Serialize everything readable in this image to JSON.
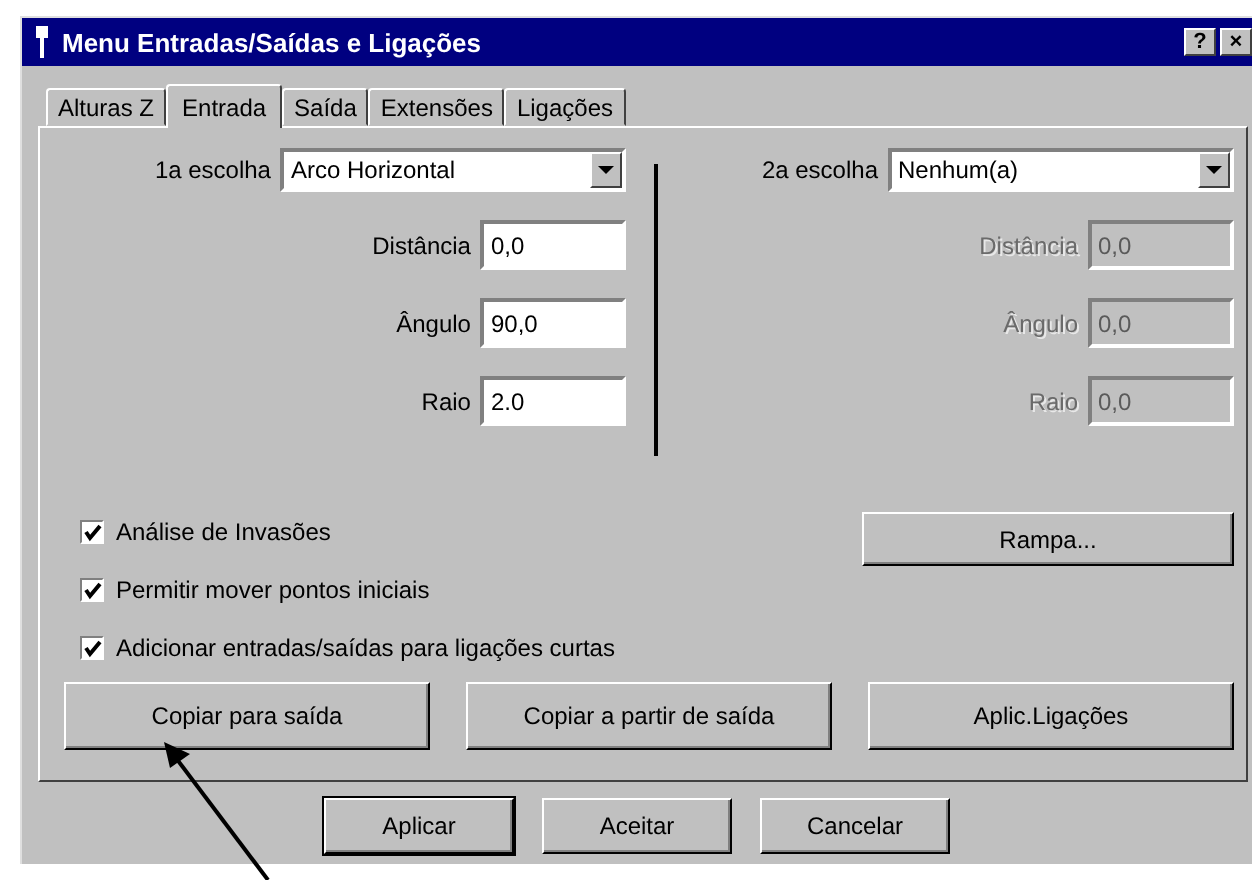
{
  "window": {
    "title": "Menu Entradas/Saídas e Ligações",
    "title_buttons": [
      "?",
      "×"
    ]
  },
  "tabs": [
    {
      "label": "Alturas Z",
      "selected": false
    },
    {
      "label": "Entrada",
      "selected": true
    },
    {
      "label": "Saída",
      "selected": false
    },
    {
      "label": "Extensões",
      "selected": false
    },
    {
      "label": "Ligações",
      "selected": false
    }
  ],
  "groups": [
    {
      "choice_label": "1a escolha",
      "choice_value": "Arco Horizontal",
      "fields": [
        {
          "label": "Distância",
          "value": "0,0",
          "disabled": false
        },
        {
          "label": "Ângulo",
          "value": "90,0",
          "disabled": false
        },
        {
          "label": "Raio",
          "value": "2.0",
          "disabled": false
        }
      ]
    },
    {
      "choice_label": "2a escolha",
      "choice_value": "Nenhum(a)",
      "fields": [
        {
          "label": "Distância",
          "value": "0,0",
          "disabled": true
        },
        {
          "label": "Ângulo",
          "value": "0,0",
          "disabled": true
        },
        {
          "label": "Raio",
          "value": "0,0",
          "disabled": true
        }
      ]
    }
  ],
  "checkboxes": [
    {
      "label": "Análise de Invasões",
      "checked": true
    },
    {
      "label": "Permitir mover pontos iniciais",
      "checked": true
    },
    {
      "label": "Adicionar entradas/saídas para ligações curtas",
      "checked": true
    }
  ],
  "side_button": "Rampa...",
  "action_buttons": [
    "Copiar para saída",
    "Copiar a partir de saída",
    "Aplic.Ligações"
  ],
  "dialog_buttons": [
    {
      "label": "Aplicar",
      "default": true
    },
    {
      "label": "Aceitar",
      "default": false
    },
    {
      "label": "Cancelar",
      "default": false
    }
  ]
}
